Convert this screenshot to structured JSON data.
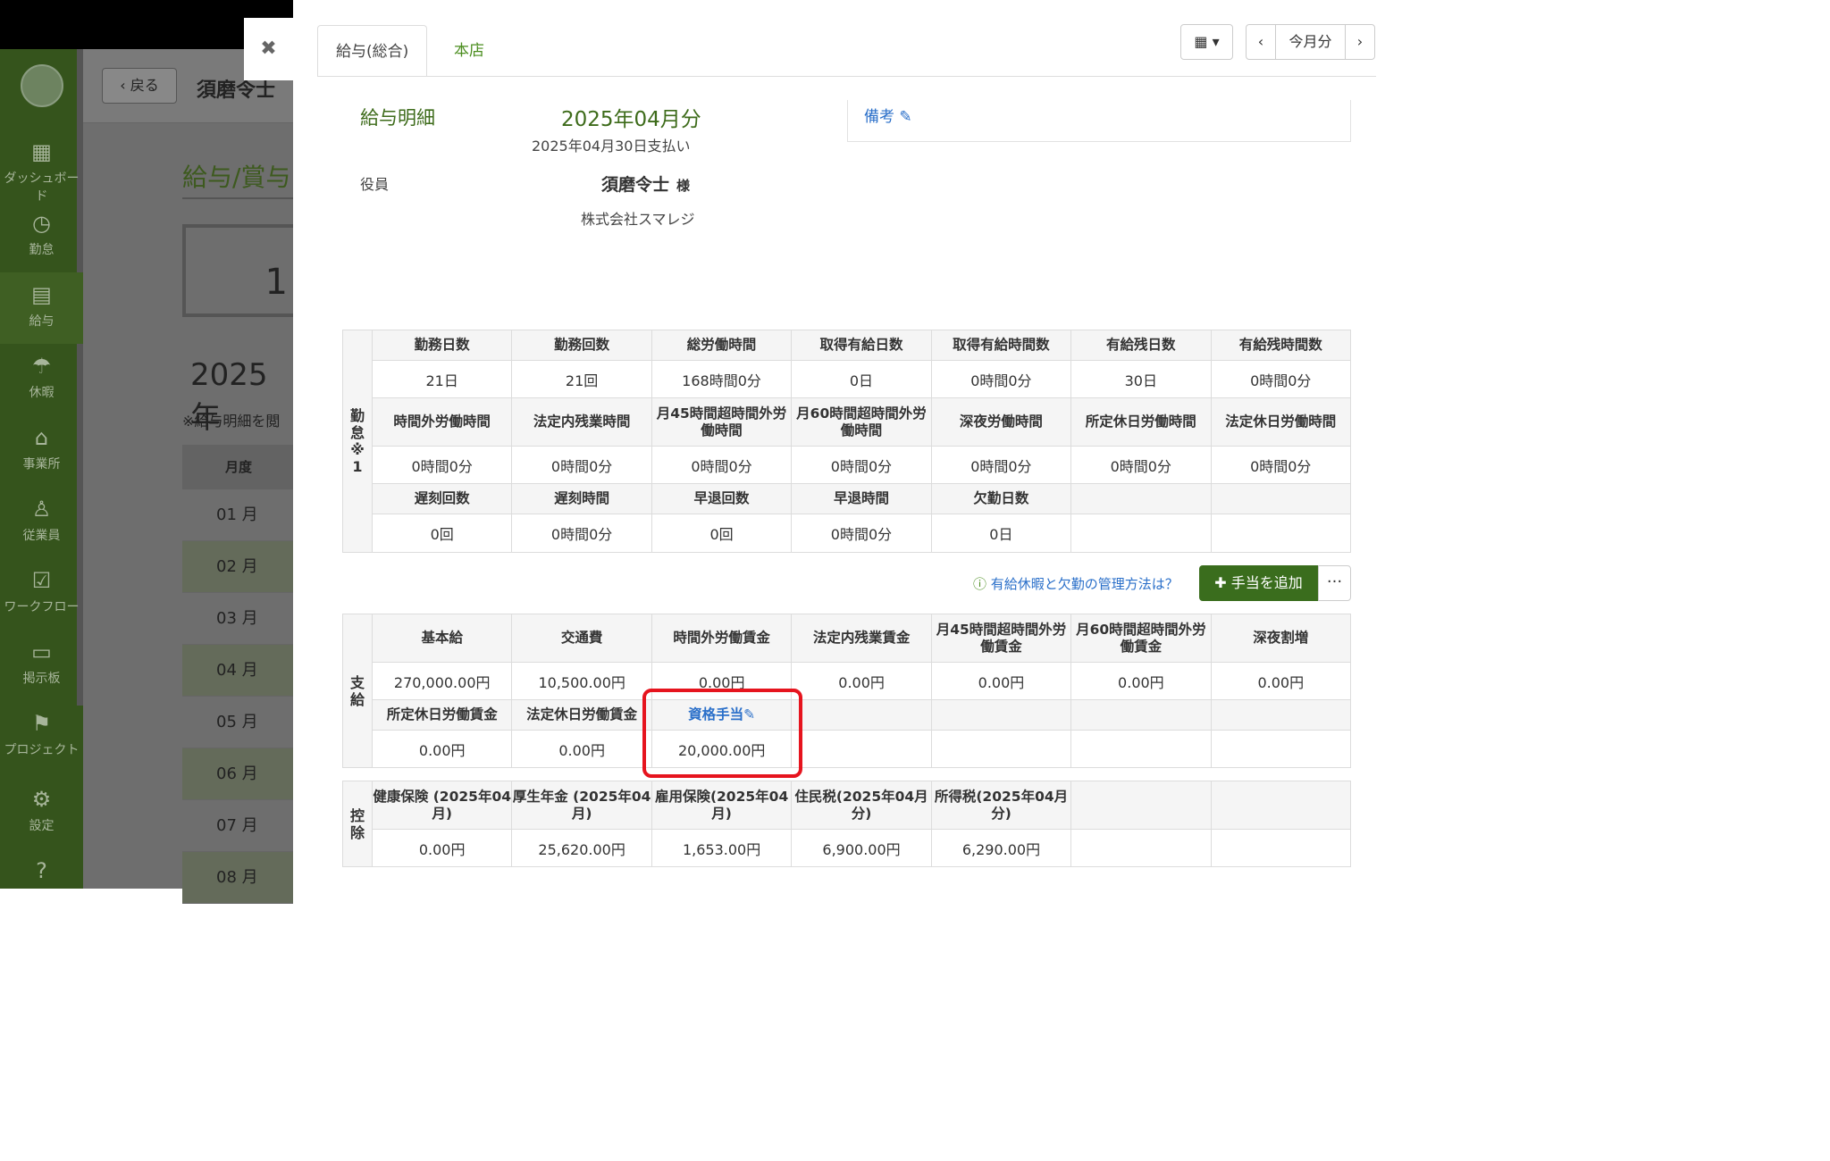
{
  "sidebar": {
    "items": [
      {
        "label": "ダッシュボード",
        "icon": "dashboard-icon"
      },
      {
        "label": "勤怠",
        "icon": "clock-icon"
      },
      {
        "label": "給与",
        "icon": "calculator-icon"
      },
      {
        "label": "休暇",
        "icon": "umbrella-icon"
      },
      {
        "label": "事業所",
        "icon": "home-icon"
      },
      {
        "label": "従業員",
        "icon": "user-icon"
      },
      {
        "label": "ワークフロー",
        "icon": "clipboard-check-icon"
      },
      {
        "label": "掲示板",
        "icon": "message-icon"
      },
      {
        "label": "プロジェクト",
        "icon": "flag-icon"
      },
      {
        "label": "設定",
        "icon": "gear-icon"
      }
    ]
  },
  "background": {
    "back_label": "戻る",
    "name": "須磨令士",
    "title": "給与/賞与",
    "box_digit": "1",
    "year": "2025年",
    "note": "※給与明細を閲",
    "month_header": "月度",
    "months": [
      "01 月",
      "02 月",
      "03 月",
      "04 月",
      "05 月",
      "06 月",
      "07 月",
      "08 月"
    ]
  },
  "panel": {
    "tabs": [
      "給与(総合)",
      "本店"
    ],
    "month_button": "今月分",
    "slip_title": "給与明細",
    "slip_month": "2025年04月分",
    "paid_date": "2025年04月30日支払い",
    "role": "役員",
    "employee_name": "須磨令士",
    "honorific": "様",
    "company": "株式会社スマレジ",
    "remarks_label": "備考",
    "help_link": "有給休暇と欠勤の管理方法は？",
    "add_allowance": "手当を追加",
    "more": "···"
  },
  "attendance": {
    "section_label": "勤怠※1",
    "row1_headers": [
      "勤務日数",
      "勤務回数",
      "総労働時間",
      "取得有給日数",
      "取得有給時間数",
      "有給残日数",
      "有給残時間数"
    ],
    "row1_values": [
      "21日",
      "21回",
      "168時間0分",
      "0日",
      "0時間0分",
      "30日",
      "0時間0分"
    ],
    "row2_headers": [
      "時間外労働時間",
      "法定内残業時間",
      "月45時間超時間外労働時間",
      "月60時間超時間外労働時間",
      "深夜労働時間",
      "所定休日労働時間",
      "法定休日労働時間"
    ],
    "row2_values": [
      "0時間0分",
      "0時間0分",
      "0時間0分",
      "0時間0分",
      "0時間0分",
      "0時間0分",
      "0時間0分"
    ],
    "row3_headers": [
      "遅刻回数",
      "遅刻時間",
      "早退回数",
      "早退時間",
      "欠勤日数",
      "",
      ""
    ],
    "row3_values": [
      "0回",
      "0時間0分",
      "0回",
      "0時間0分",
      "0日",
      "",
      ""
    ]
  },
  "payment": {
    "section_label": "支給",
    "row1_headers": [
      "基本給",
      "交通費",
      "時間外労働賃金",
      "法定内残業賃金",
      "月45時間超時間外労働賃金",
      "月60時間超時間外労働賃金",
      "深夜割増"
    ],
    "row1_values": [
      "270,000.00円",
      "10,500.00円",
      "0.00円",
      "0.00円",
      "0.00円",
      "0.00円",
      "0.00円"
    ],
    "row2_headers": [
      "所定休日労働賃金",
      "法定休日労働賃金",
      "資格手当",
      "",
      "",
      "",
      ""
    ],
    "row2_values": [
      "0.00円",
      "0.00円",
      "20,000.00円",
      "",
      "",
      "",
      ""
    ]
  },
  "deduction": {
    "section_label": "控除",
    "headers": [
      "健康保険 (2025年04月)",
      "厚生年金 (2025年04月)",
      "雇用保険(2025年04月)",
      "住民税(2025年04月分)",
      "所得税(2025年04月分)",
      "",
      ""
    ],
    "values": [
      "0.00円",
      "25,620.00円",
      "1,653.00円",
      "6,900.00円",
      "6,290.00円",
      "",
      ""
    ]
  }
}
